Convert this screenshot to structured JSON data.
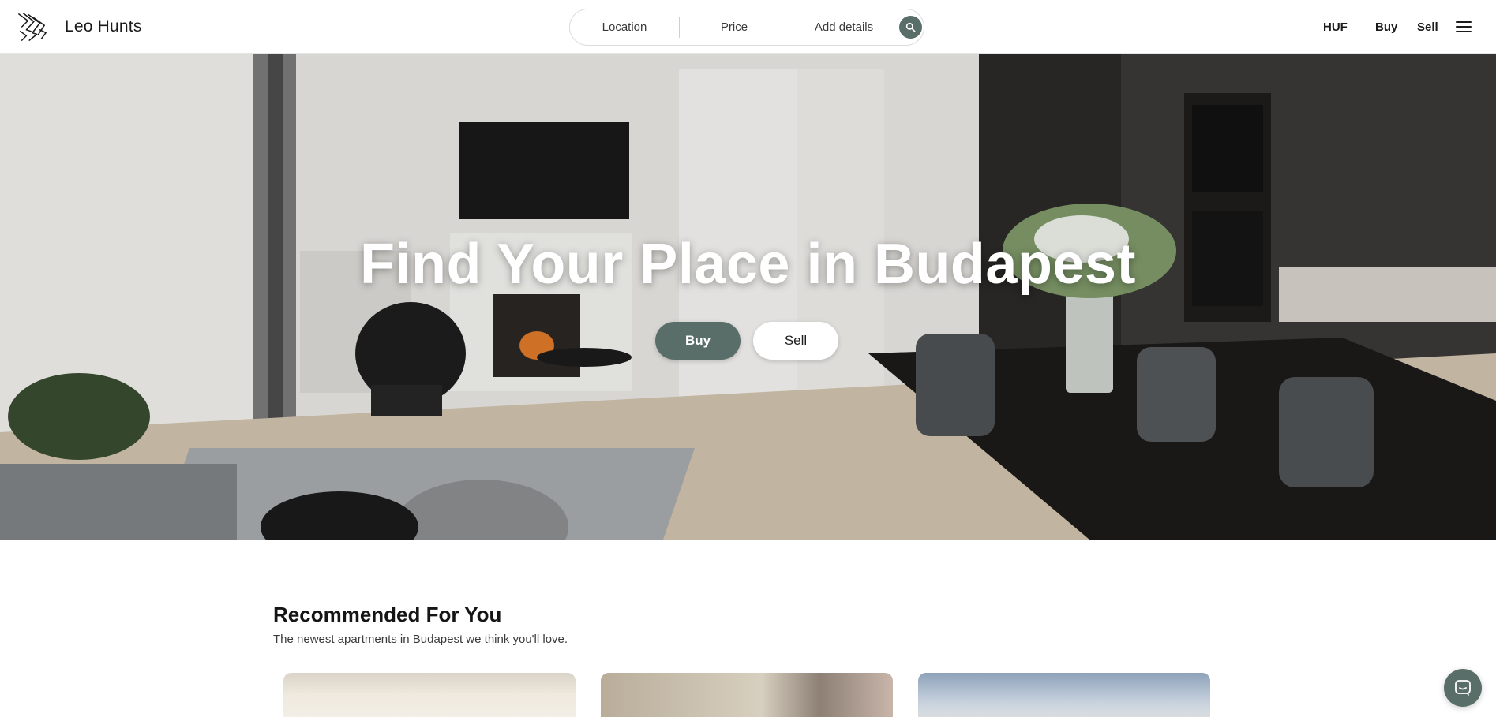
{
  "brand": {
    "name": "Leo Hunts",
    "logo_icon": "leo-hunts-logo-icon"
  },
  "search": {
    "location_label": "Location",
    "price_label": "Price",
    "details_label": "Add details",
    "button_icon": "search-icon"
  },
  "nav": {
    "currency_label": "HUF",
    "buy_label": "Buy",
    "sell_label": "Sell",
    "menu_icon": "hamburger-menu-icon"
  },
  "hero": {
    "title": "Find Your Place in Budapest",
    "buy_label": "Buy",
    "sell_label": "Sell"
  },
  "recommended": {
    "title": "Recommended For You",
    "subtitle": "The newest apartments in Budapest we think you'll love."
  },
  "chat": {
    "icon": "chat-icon"
  },
  "colors": {
    "accent": "#5a6e69",
    "text": "#1b1b1b",
    "background": "#ffffff"
  }
}
